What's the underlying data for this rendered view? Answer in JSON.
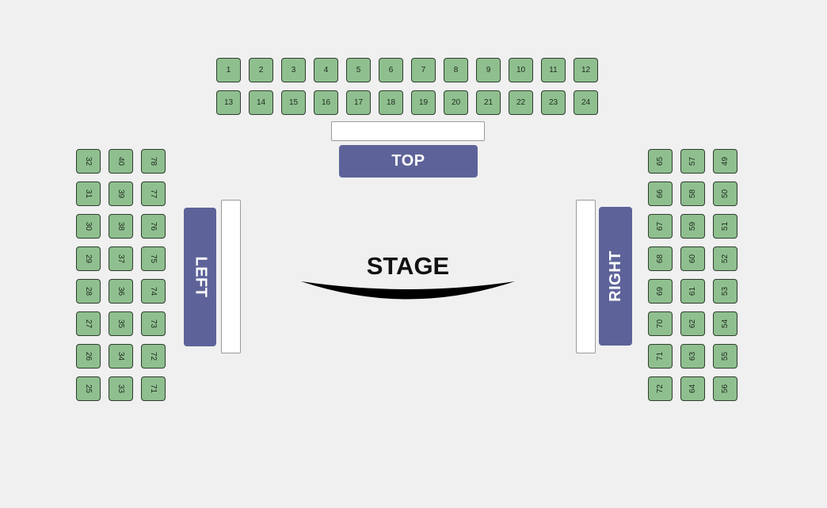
{
  "colors": {
    "background": "#f0f0f0",
    "seat_fill": "#8fbf8f",
    "seat_border": "#2f3d2f",
    "section_fill": "#5d6399",
    "section_text": "#ffffff"
  },
  "stage": {
    "label": "STAGE"
  },
  "sections": {
    "top": {
      "label": "TOP"
    },
    "left": {
      "label": "LEFT"
    },
    "right": {
      "label": "RIGHT"
    }
  },
  "seats": {
    "top_row_1": [
      "1",
      "2",
      "3",
      "4",
      "5",
      "6",
      "7",
      "8",
      "9",
      "10",
      "11",
      "12"
    ],
    "top_row_2": [
      "13",
      "14",
      "15",
      "16",
      "17",
      "18",
      "19",
      "20",
      "21",
      "22",
      "23",
      "24"
    ],
    "left_col_1": [
      "32",
      "31",
      "30",
      "29",
      "28",
      "27",
      "26",
      "25"
    ],
    "left_col_2": [
      "40",
      "39",
      "38",
      "37",
      "36",
      "35",
      "34",
      "33"
    ],
    "left_col_3": [
      "78",
      "77",
      "76",
      "75",
      "74",
      "73",
      "72",
      "71"
    ],
    "right_col_1": [
      "65",
      "66",
      "67",
      "68",
      "69",
      "70",
      "71",
      "72"
    ],
    "right_col_2": [
      "57",
      "58",
      "59",
      "60",
      "61",
      "62",
      "63",
      "64"
    ],
    "right_col_3": [
      "49",
      "50",
      "51",
      "52",
      "53",
      "54",
      "55",
      "56"
    ]
  }
}
